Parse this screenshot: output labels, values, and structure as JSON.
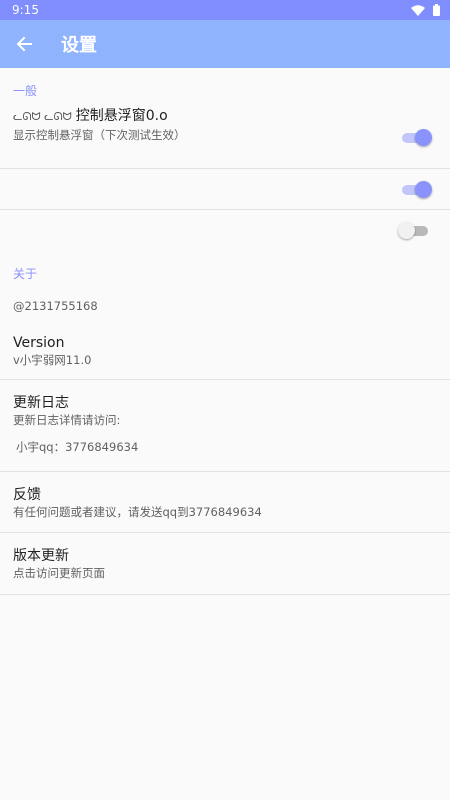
{
  "status_bar": {
    "time": "9:15",
    "wifi_icon": "wifi-icon",
    "battery_icon": "battery-icon"
  },
  "app_bar": {
    "title": "设置",
    "back_icon": "arrow-back-icon"
  },
  "sections": {
    "general": {
      "header": "一般",
      "float_window": {
        "prefix": "ᓚᘏᗢ ᓚᘏᗢ",
        "title": "控制悬浮窗0.o",
        "summary": "显示控制悬浮窗（下次测试生效）",
        "enabled": true
      },
      "switch2_enabled": true,
      "switch3_enabled": false
    },
    "about": {
      "header": "关于",
      "account": "@2131755168",
      "version": {
        "title": "Version",
        "summary": "v小宇弱网11.0"
      },
      "changelog": {
        "title": "更新日志",
        "summary": "更新日志详情请访问:",
        "detail": "小宇qq：3776849634"
      },
      "feedback": {
        "title": "反馈",
        "summary": "有任何问题或者建议，请发送qq到3776849634"
      },
      "update": {
        "title": "版本更新",
        "summary": "点击访问更新页面"
      }
    }
  },
  "colors": {
    "status_bar": "#7f8dfd",
    "app_bar": "#8fb3fd",
    "accent": "#8a93fb"
  }
}
